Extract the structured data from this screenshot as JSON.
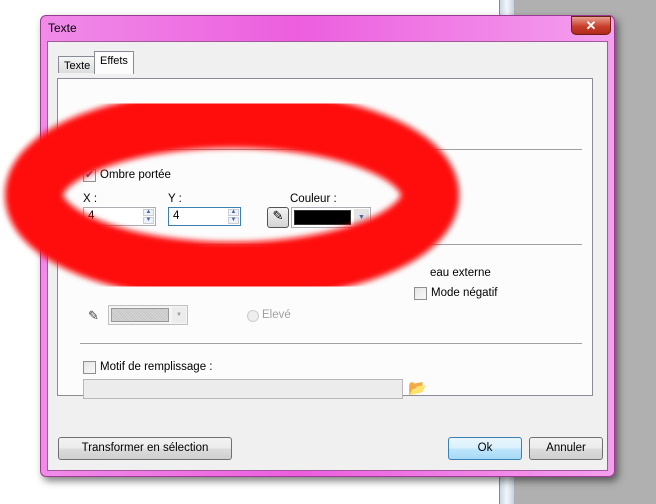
{
  "dialog": {
    "title": "Texte",
    "close_icon": "close-icon"
  },
  "tabs": [
    {
      "label": "Texte",
      "active": false
    },
    {
      "label": "Effets",
      "active": true
    }
  ],
  "shadow": {
    "checkbox_label": "Ombre portée",
    "checked": true,
    "x_label": "X :",
    "x_value": "4",
    "y_label": "Y :",
    "y_value": "4",
    "color_label": "Couleur :",
    "color_value": "#000000"
  },
  "partial": {
    "outer_label": "eau externe",
    "negative_label": "Mode négatif",
    "raised_label": "Elevé",
    "swatch_color": "#c8c8c8"
  },
  "pattern": {
    "checkbox_label": "Motif de remplissage :",
    "checked": false,
    "path_value": ""
  },
  "buttons": {
    "transform": "Transformer en sélection",
    "ok": "Ok",
    "cancel": "Annuler"
  },
  "annotation_color": "#ff0a0a"
}
